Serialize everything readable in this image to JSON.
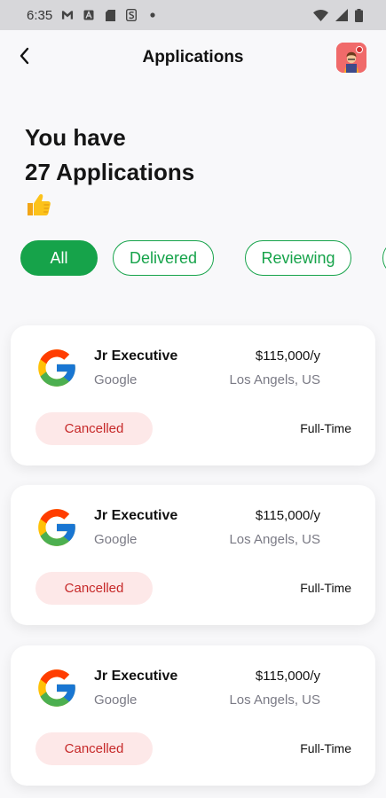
{
  "status_bar": {
    "time": "6:35",
    "left_icons": [
      "gmail-icon",
      "a-icon",
      "sd-card-icon",
      "s-icon",
      "dot-icon"
    ],
    "right_icons": [
      "wifi-icon",
      "signal-icon",
      "battery-icon"
    ]
  },
  "header": {
    "title": "Applications",
    "back_icon": "chevron-left-icon",
    "avatar_icon": "avatar-icon"
  },
  "hero": {
    "line1": "You have",
    "line2": "27 Applications",
    "emoji": "👍"
  },
  "filters": [
    {
      "label": "All",
      "active": true
    },
    {
      "label": "Delivered",
      "active": false
    },
    {
      "label": "Reviewing",
      "active": false
    }
  ],
  "applications": [
    {
      "title": "Jr Executive",
      "company": "Google",
      "salary": "$115,000/y",
      "location": "Los Angels, US",
      "status": "Cancelled",
      "type": "Full-Time"
    },
    {
      "title": "Jr Executive",
      "company": "Google",
      "salary": "$115,000/y",
      "location": "Los Angels, US",
      "status": "Cancelled",
      "type": "Full-Time"
    },
    {
      "title": "Jr Executive",
      "company": "Google",
      "salary": "$115,000/y",
      "location": "Los Angels, US",
      "status": "Cancelled",
      "type": "Full-Time"
    }
  ],
  "colors": {
    "accent": "#16a34a",
    "status_bg": "#fde8e8",
    "status_text": "#c62828",
    "avatar_bg": "#f06a6a"
  }
}
